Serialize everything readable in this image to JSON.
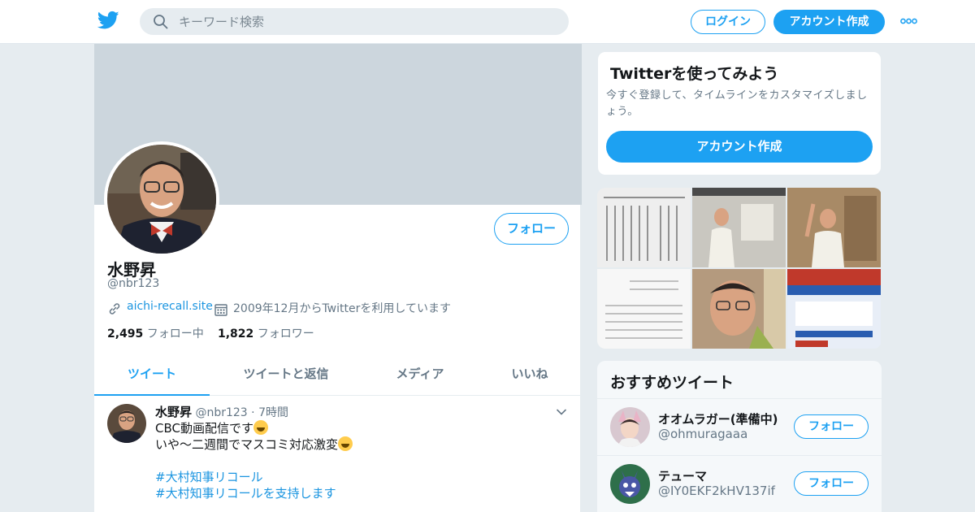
{
  "header": {
    "search_placeholder": "キーワード検索",
    "login_label": "ログイン",
    "signup_label": "アカウント作成",
    "brand_color": "#1da1f2"
  },
  "profile": {
    "name": "水野昇",
    "handle": "@nbr123",
    "follow_label": "フォロー",
    "website": "aichi-recall.site",
    "joined": "2009年12月からTwitterを利用しています",
    "following_count": "2,495",
    "following_label": "フォロー中",
    "followers_count": "1,822",
    "followers_label": "フォロワー"
  },
  "tabs": [
    {
      "label": "ツイート",
      "active": true
    },
    {
      "label": "ツイートと返信",
      "active": false
    },
    {
      "label": "メディア",
      "active": false
    },
    {
      "label": "いいね",
      "active": false
    }
  ],
  "tweet": {
    "author": "水野昇",
    "handle": "@nbr123",
    "sep": "·",
    "time": "7時間",
    "line1": "CBC動画配信です",
    "line2": "いや〜二週間でマスコミ対応激変",
    "hashtag1": "#大村知事リコール",
    "hashtag2": "#大村知事リコールを支持します"
  },
  "signup_card": {
    "title": "Twitterを使ってみよう",
    "description": "今すぐ登録して、タイムラインをカスタマイズしましょう。",
    "button": "アカウント作成"
  },
  "recommended": {
    "title": "おすすめツイート",
    "items": [
      {
        "name": "オオムラガー(準備中)",
        "handle": "@ohmuragaaa",
        "button": "フォロー"
      },
      {
        "name": "テューマ",
        "handle": "@IY0EKF2kHV137if",
        "button": "フォロー"
      }
    ]
  }
}
